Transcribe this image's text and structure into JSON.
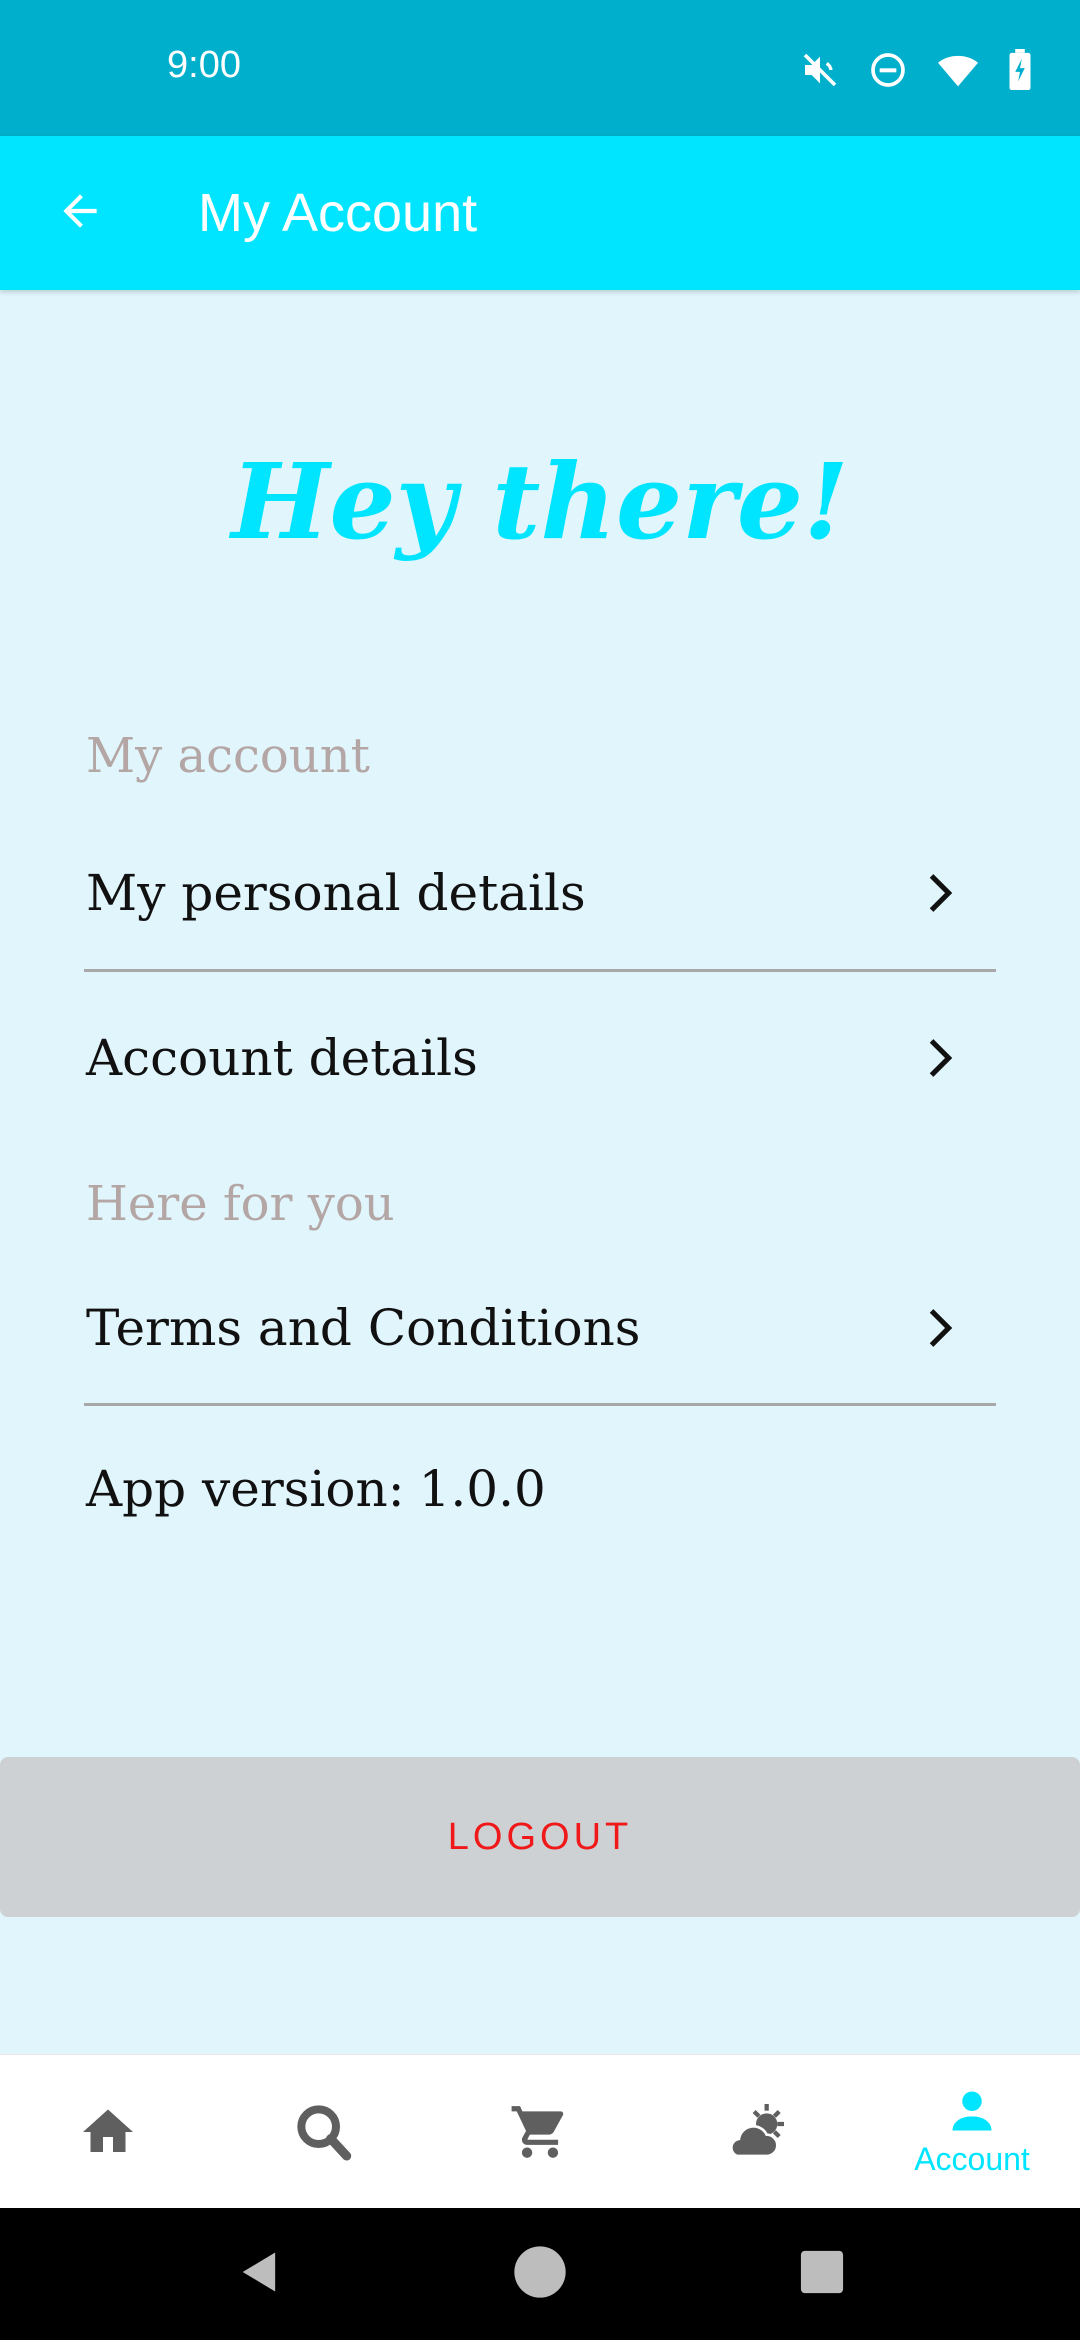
{
  "status_bar": {
    "time": "9:00",
    "icons": [
      "mute-icon",
      "do-not-disturb-icon",
      "wifi-icon",
      "battery-charging-icon"
    ]
  },
  "app_bar": {
    "title": "My Account",
    "back_icon": "arrow-back-icon"
  },
  "greeting": "Hey there!",
  "sections": {
    "my_account": {
      "header": "My account",
      "items": [
        "My personal details",
        "Account details"
      ]
    },
    "here_for_you": {
      "header": "Here for you",
      "items": [
        "Terms and Conditions"
      ]
    }
  },
  "version": {
    "label": "App version:",
    "value": "1.0.0"
  },
  "logout_label": "LOGOUT",
  "bottom_nav": {
    "items": [
      {
        "icon": "home-icon",
        "label": ""
      },
      {
        "icon": "search-icon",
        "label": ""
      },
      {
        "icon": "cart-icon",
        "label": ""
      },
      {
        "icon": "weather-icon",
        "label": ""
      },
      {
        "icon": "account-icon",
        "label": "Account"
      }
    ],
    "active_index": 4
  },
  "colors": {
    "status_bar": "#00AFCB",
    "accent": "#00E5FF",
    "background": "#E1F5FC",
    "section_header": "#B3A6A4",
    "logout_bg": "#CDD1D4",
    "logout_text": "#F01818",
    "nav_inactive": "#5F5F5F"
  }
}
